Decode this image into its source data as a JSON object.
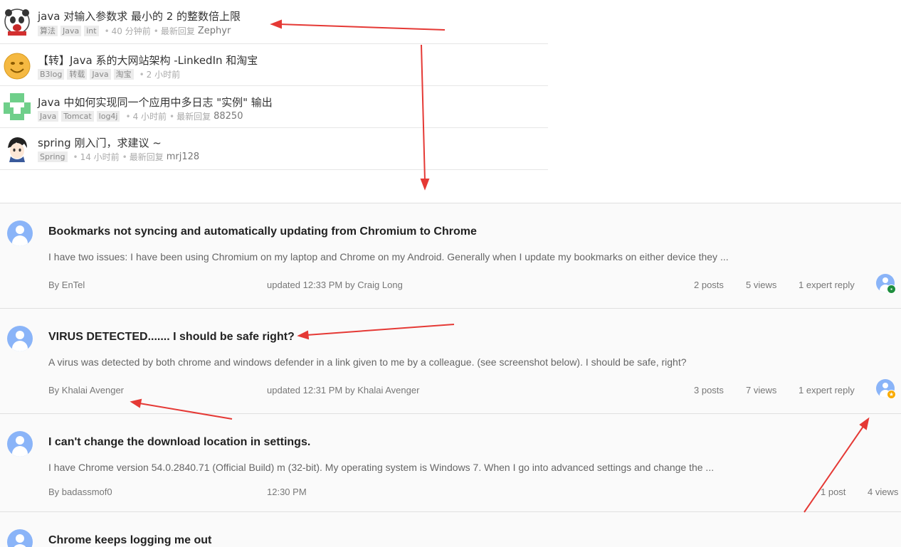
{
  "cn_posts": [
    {
      "title": "java 对输入参数求 最小的 2 的整数倍上限",
      "avatar_icon": "panda-mascot-avatar",
      "tags": [
        "算法",
        "Java",
        "int"
      ],
      "time": "40 分钟前",
      "latest_label": "最新回复",
      "latest_user": "Zephyr"
    },
    {
      "title": "【转】Java 系的大网站架构 -LinkedIn 和淘宝",
      "avatar_icon": "smiley-face-avatar",
      "tags": [
        "B3log",
        "转载",
        "Java",
        "淘宝"
      ],
      "time": "2 小时前",
      "latest_label": "",
      "latest_user": ""
    },
    {
      "title": "Java 中如何实现同一个应用中多日志 \"实例\" 输出",
      "avatar_icon": "green-identicon-avatar",
      "tags": [
        "Java",
        "Tomcat",
        "log4j"
      ],
      "time": "4 小时前",
      "latest_label": "最新回复",
      "latest_user": "88250"
    },
    {
      "title": "spring 刚入门，求建议 ~",
      "avatar_icon": "anime-character-avatar",
      "tags": [
        "Spring"
      ],
      "time": "14 小时前",
      "latest_label": "最新回复",
      "latest_user": "mrj128"
    }
  ],
  "threads": [
    {
      "title": "Bookmarks not syncing and automatically updating from Chromium to Chrome",
      "snippet": "I have two issues: I have been using Chromium on my laptop and Chrome on my Android. Generally when I update my bookmarks on either device they ...",
      "by": "By EnTel",
      "updated": "updated 12:33 PM by Craig Long",
      "posts": "2 posts",
      "views": "5 views",
      "expert": "1 expert reply",
      "badge": "green"
    },
    {
      "title": "VIRUS DETECTED....... I should be safe right?",
      "snippet": "A virus was detected by both chrome and windows defender in a link given to me by a colleague. (see screenshot below). I should be safe, right?",
      "by": "By Khalai Avenger",
      "updated": "updated 12:31 PM by Khalai Avenger",
      "posts": "3 posts",
      "views": "7 views",
      "expert": "1 expert reply",
      "badge": "gold"
    },
    {
      "title": "I can't change the download location in settings.",
      "snippet": "I have Chrome version 54.0.2840.71 (Official Build) m (32-bit). My operating system is Windows 7. When I go into advanced settings and change the ...",
      "by": "By badassmof0",
      "updated": "12:30 PM",
      "posts": "1 post",
      "views": "4 views",
      "expert": "",
      "badge": ""
    },
    {
      "title": "Chrome keeps logging me out",
      "snippet": "",
      "by": "",
      "updated": "",
      "posts": "",
      "views": "",
      "expert": "",
      "badge": ""
    }
  ],
  "colors": {
    "annotation_arrow": "#e53935",
    "avatar_blue": "#8ab4f8",
    "badge_green": "#1e8e3e",
    "badge_gold": "#f9ab00"
  }
}
